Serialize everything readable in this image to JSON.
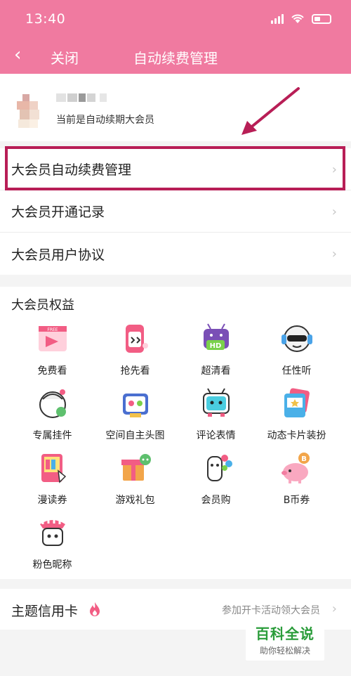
{
  "status_bar": {
    "time": "13:40"
  },
  "nav": {
    "back_icon": "‹",
    "close_label": "关闭",
    "title": "自动续费管理"
  },
  "user": {
    "status": "当前是自动续期大会员"
  },
  "menu": {
    "items": [
      {
        "label": "大会员自动续费管理"
      },
      {
        "label": "大会员开通记录"
      },
      {
        "label": "大会员用户协议"
      }
    ]
  },
  "benefits": {
    "title": "大会员权益",
    "items": [
      {
        "label": "免费看",
        "icon": "free-watch-icon"
      },
      {
        "label": "抢先看",
        "icon": "early-watch-icon"
      },
      {
        "label": "超清看",
        "icon": "hd-icon"
      },
      {
        "label": "任性听",
        "icon": "listen-icon"
      },
      {
        "label": "专属挂件",
        "icon": "pendant-icon"
      },
      {
        "label": "空间自主头图",
        "icon": "space-header-icon"
      },
      {
        "label": "评论表情",
        "icon": "emoji-icon"
      },
      {
        "label": "动态卡片装扮",
        "icon": "card-decor-icon"
      },
      {
        "label": "漫读券",
        "icon": "comic-coupon-icon"
      },
      {
        "label": "游戏礼包",
        "icon": "game-gift-icon"
      },
      {
        "label": "会员购",
        "icon": "member-shop-icon"
      },
      {
        "label": "B币券",
        "icon": "bcoin-coupon-icon"
      },
      {
        "label": "粉色昵称",
        "icon": "pink-nickname-icon"
      }
    ]
  },
  "credit_card": {
    "title": "主题信用卡",
    "promo": "参加开卡活动领大会员"
  },
  "watermark": {
    "brand": "百科全说",
    "slogan": "助你轻松解决"
  },
  "colors": {
    "accent": "#f07aa0",
    "highlight": "#b81e56"
  }
}
